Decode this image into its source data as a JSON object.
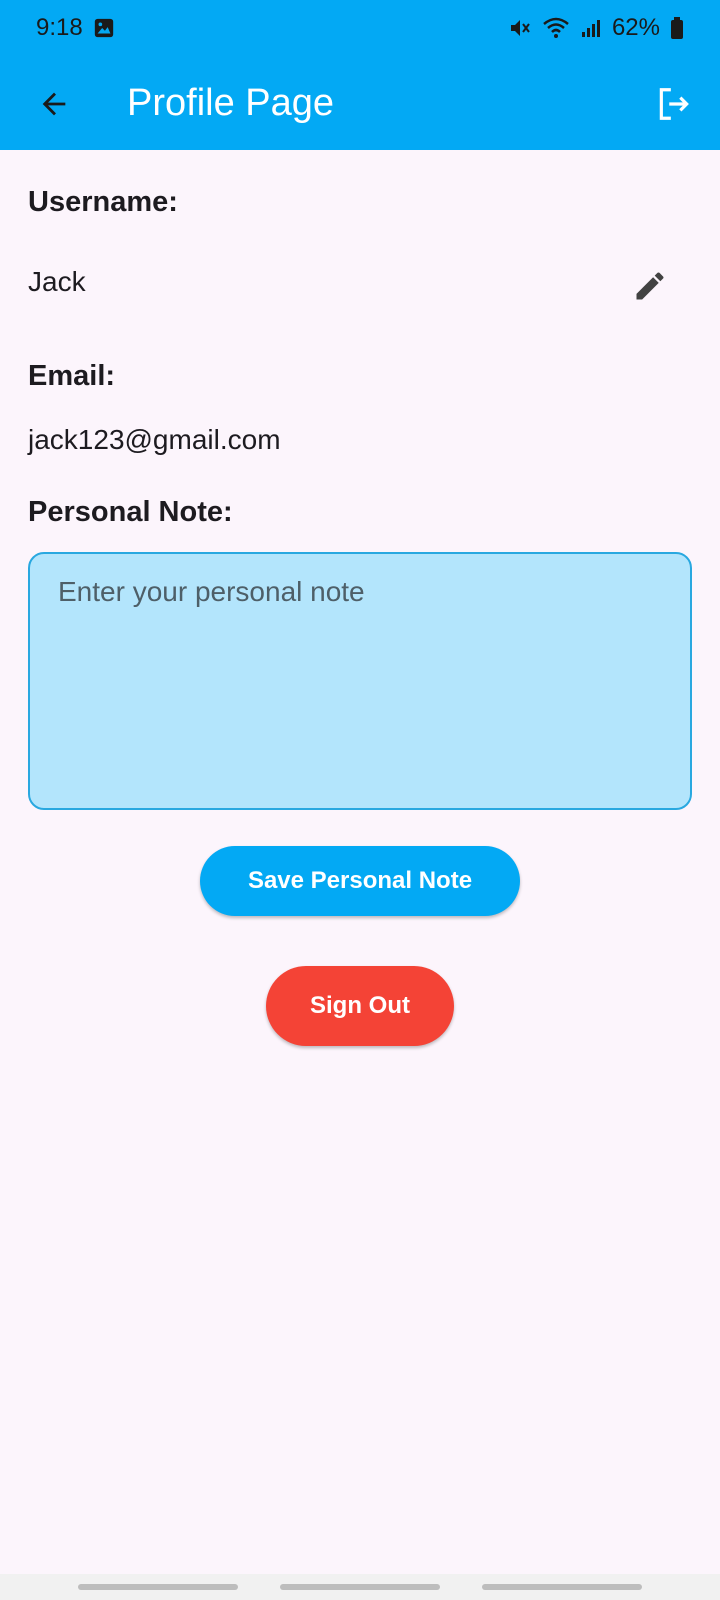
{
  "status_bar": {
    "time": "9:18",
    "battery": "62%",
    "icons": [
      "gallery-icon",
      "mute-icon",
      "wifi-icon",
      "signal-icon",
      "battery-icon"
    ]
  },
  "app_bar": {
    "title": "Profile Page",
    "back_icon": "arrow-back-icon",
    "logout_icon": "logout-icon",
    "color": "#03a9f4"
  },
  "profile": {
    "username_label": "Username:",
    "username_value": "Jack",
    "email_label": "Email:",
    "email_value": "jack123@gmail.com",
    "note_label": "Personal Note:",
    "note_placeholder": "Enter your personal note",
    "note_value": ""
  },
  "actions": {
    "save_label": "Save Personal Note",
    "signout_label": "Sign Out",
    "save_color": "#03a9f4",
    "signout_color": "#f44336"
  }
}
